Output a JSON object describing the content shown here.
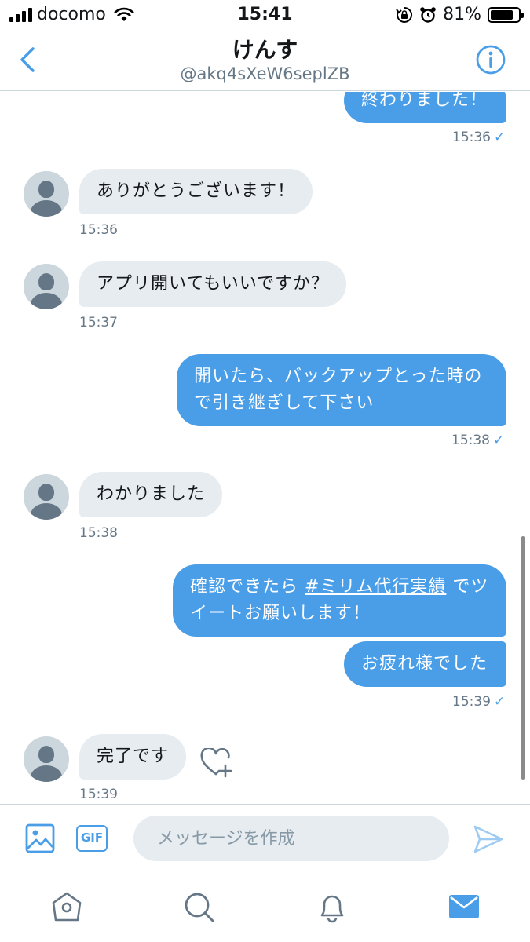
{
  "status_bar": {
    "carrier": "docomo",
    "time": "15:41",
    "battery_percent": "81%",
    "battery_level": 0.81,
    "icons": [
      "signal-icon",
      "wifi-icon",
      "orientation-lock-icon",
      "alarm-icon",
      "battery-icon"
    ]
  },
  "header": {
    "title": "けんす",
    "handle": "@akq4sXeW6seplZB",
    "icons": [
      "back-chevron-icon",
      "info-icon"
    ]
  },
  "messages": [
    {
      "direction": "out",
      "text": "終わりました！",
      "time": "15:36",
      "status": "✓"
    },
    {
      "direction": "in",
      "text": "ありがとうございます！",
      "time": "15:36"
    },
    {
      "direction": "in",
      "text": "アプリ開いてもいいですか？",
      "time": "15:37"
    },
    {
      "direction": "out",
      "text_lines": [
        "開いたら、バックアップとった時の",
        "で引き継ぎして下さい"
      ],
      "time": "15:38",
      "status": "✓"
    },
    {
      "direction": "in",
      "text": "わかりました",
      "time": "15:38"
    },
    {
      "direction": "out",
      "text_before": "確認できたら ",
      "hashtag": "#ミリム代行実績",
      "text_after": " でツ",
      "text_line2": "イートお願いします！"
    },
    {
      "direction": "out",
      "text": "お疲れ様でした",
      "time": "15:39",
      "status": "✓"
    },
    {
      "direction": "in",
      "text": "完了です",
      "time": "15:39",
      "reaction_icon": "heart-plus-icon"
    }
  ],
  "composer": {
    "placeholder": "メッセージを作成",
    "gif_label": "GIF",
    "icons": [
      "image-icon",
      "gif-icon",
      "send-icon"
    ]
  },
  "tabbar": {
    "items": [
      "home-icon",
      "search-icon",
      "notifications-icon",
      "messages-icon"
    ],
    "active": "messages-icon"
  },
  "colors": {
    "accent": "#4a9ee8",
    "incoming_bubble": "#e6ecf0",
    "secondary_text": "#657786",
    "divider": "#ccd6dd"
  }
}
